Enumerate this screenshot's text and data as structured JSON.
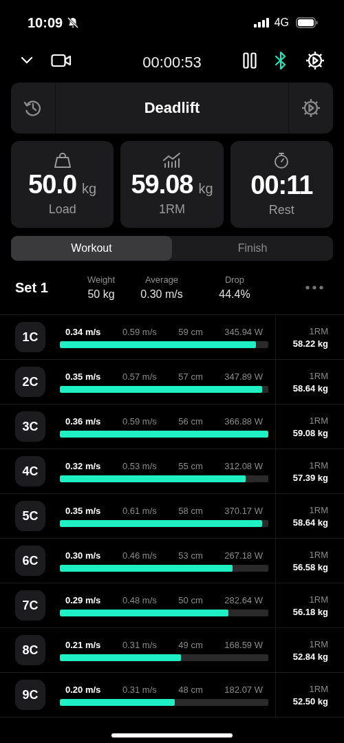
{
  "status_bar": {
    "time": "10:09",
    "network": "4G"
  },
  "toolbar": {
    "timer": "00:00:53"
  },
  "exercise": {
    "title": "Deadlift"
  },
  "stats": [
    {
      "kind": "load",
      "value": "50.0",
      "unit": "kg",
      "label": "Load"
    },
    {
      "kind": "orm",
      "value": "59.08",
      "unit": "kg",
      "label": "1RM"
    },
    {
      "kind": "rest",
      "value": "00:11",
      "label": "Rest"
    }
  ],
  "tabs": [
    {
      "label": "Workout",
      "selected": true
    },
    {
      "label": "Finish",
      "selected": false
    }
  ],
  "set": {
    "title": "Set 1",
    "metrics": [
      {
        "label": "Weight",
        "value": "50 kg"
      },
      {
        "label": "Average",
        "value": "0.30 m/s"
      },
      {
        "label": "Drop",
        "value": "44.4%"
      }
    ]
  },
  "reps": [
    {
      "badge": "1C",
      "velocity": "0.34 m/s",
      "peak": "0.59 m/s",
      "distance": "59 cm",
      "power": "345.94 W",
      "level": 0.94,
      "orm_label": "1RM",
      "orm": "58.22 kg"
    },
    {
      "badge": "2C",
      "velocity": "0.35 m/s",
      "peak": "0.57 m/s",
      "distance": "57 cm",
      "power": "347.89 W",
      "level": 0.97,
      "orm_label": "1RM",
      "orm": "58.64 kg"
    },
    {
      "badge": "3C",
      "velocity": "0.36 m/s",
      "peak": "0.59 m/s",
      "distance": "56 cm",
      "power": "366.88 W",
      "level": 1.0,
      "orm_label": "1RM",
      "orm": "59.08 kg"
    },
    {
      "badge": "4C",
      "velocity": "0.32 m/s",
      "peak": "0.53 m/s",
      "distance": "55 cm",
      "power": "312.08 W",
      "level": 0.89,
      "orm_label": "1RM",
      "orm": "57.39 kg"
    },
    {
      "badge": "5C",
      "velocity": "0.35 m/s",
      "peak": "0.61 m/s",
      "distance": "58 cm",
      "power": "370.17 W",
      "level": 0.97,
      "orm_label": "1RM",
      "orm": "58.64 kg"
    },
    {
      "badge": "6C",
      "velocity": "0.30 m/s",
      "peak": "0.46 m/s",
      "distance": "53 cm",
      "power": "267.18 W",
      "level": 0.83,
      "orm_label": "1RM",
      "orm": "56.58 kg"
    },
    {
      "badge": "7C",
      "velocity": "0.29 m/s",
      "peak": "0.48 m/s",
      "distance": "50 cm",
      "power": "282.64 W",
      "level": 0.81,
      "orm_label": "1RM",
      "orm": "56.18 kg"
    },
    {
      "badge": "8C",
      "velocity": "0.21 m/s",
      "peak": "0.31 m/s",
      "distance": "49 cm",
      "power": "168.59 W",
      "level": 0.58,
      "orm_label": "1RM",
      "orm": "52.84 kg"
    },
    {
      "badge": "9C",
      "velocity": "0.20 m/s",
      "peak": "0.31 m/s",
      "distance": "48 cm",
      "power": "182.07 W",
      "level": 0.55,
      "orm_label": "1RM",
      "orm": "52.50 kg"
    }
  ]
}
